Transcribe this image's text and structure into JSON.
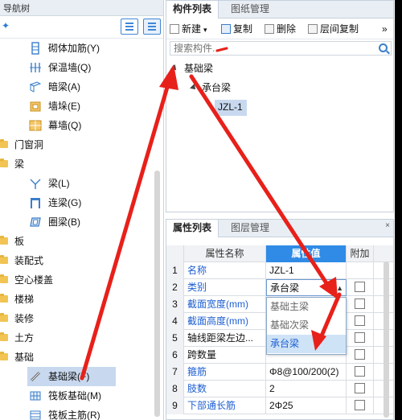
{
  "nav": {
    "title": "导航树",
    "rows": [
      {
        "kind": "item",
        "label": "砌体加筋(Y)",
        "icon": "masonry-rebar-icon"
      },
      {
        "kind": "item",
        "label": "保温墙(Q)",
        "icon": "insulation-wall-icon"
      },
      {
        "kind": "item",
        "label": "暗梁(A)",
        "icon": "hidden-beam-icon"
      },
      {
        "kind": "item",
        "label": "墙垛(E)",
        "icon": "wall-pier-icon"
      },
      {
        "kind": "item",
        "label": "幕墙(Q)",
        "icon": "curtain-wall-icon"
      },
      {
        "kind": "cat",
        "label": "门窗洞"
      },
      {
        "kind": "cat",
        "label": "梁"
      },
      {
        "kind": "item",
        "label": "梁(L)",
        "icon": "beam-icon"
      },
      {
        "kind": "item",
        "label": "连梁(G)",
        "icon": "coupling-beam-icon"
      },
      {
        "kind": "item",
        "label": "圈梁(B)",
        "icon": "ring-beam-icon"
      },
      {
        "kind": "cat",
        "label": "板"
      },
      {
        "kind": "cat",
        "label": "装配式"
      },
      {
        "kind": "cat",
        "label": "空心楼盖"
      },
      {
        "kind": "cat",
        "label": "楼梯"
      },
      {
        "kind": "cat",
        "label": "装修"
      },
      {
        "kind": "cat",
        "label": "土方"
      },
      {
        "kind": "cat",
        "label": "基础"
      },
      {
        "kind": "item",
        "label": "基础梁(F)",
        "icon": "foundation-beam-icon",
        "selected": true
      },
      {
        "kind": "item",
        "label": "筏板基础(M)",
        "icon": "raft-foundation-icon"
      },
      {
        "kind": "item",
        "label": "筏板主筋(R)",
        "icon": "raft-main-rebar-icon"
      }
    ]
  },
  "component_list": {
    "tabs": [
      "构件列表",
      "图纸管理"
    ],
    "toolbar": {
      "new": "新建",
      "copy": "复制",
      "delete": "删除",
      "layer_copy": "层间复制",
      "more": "»"
    },
    "search_placeholder": "搜索构件...",
    "tree": {
      "root": "基础梁",
      "child": "承台梁",
      "leaf": "JZL-1"
    }
  },
  "property_list": {
    "tabs": [
      "属性列表",
      "图层管理"
    ],
    "close": "×",
    "headers": {
      "name": "属性名称",
      "value": "属性值",
      "extra": "附加"
    },
    "rows": [
      {
        "num": "1",
        "name": "名称",
        "value": "JZL-1",
        "blue": true,
        "check": false
      },
      {
        "num": "2",
        "name": "类别",
        "value": "承台梁",
        "blue": true,
        "check": true,
        "editing": true
      },
      {
        "num": "3",
        "name": "截面宽度(mm)",
        "value": "",
        "blue": true,
        "check": true
      },
      {
        "num": "4",
        "name": "截面高度(mm)",
        "value": "",
        "blue": true,
        "check": true
      },
      {
        "num": "5",
        "name": "轴线距梁左边...",
        "value": "",
        "blue": false,
        "check": true
      },
      {
        "num": "6",
        "name": "跨数量",
        "value": "",
        "blue": false,
        "check": true
      },
      {
        "num": "7",
        "name": "箍筋",
        "value": "Φ8@100/200(2)",
        "blue": true,
        "check": true
      },
      {
        "num": "8",
        "name": "肢数",
        "value": "2",
        "blue": true,
        "check": true
      },
      {
        "num": "9",
        "name": "下部通长筋",
        "value": "2Φ25",
        "blue": true,
        "check": true
      }
    ],
    "dropdown": {
      "options": [
        "基础主梁",
        "基础次梁",
        "承台梁"
      ],
      "selected": "承台梁"
    }
  },
  "colors": {
    "accent": "#2f8be6",
    "arrow": "#e8201a",
    "selection": "#c8d9ef"
  }
}
